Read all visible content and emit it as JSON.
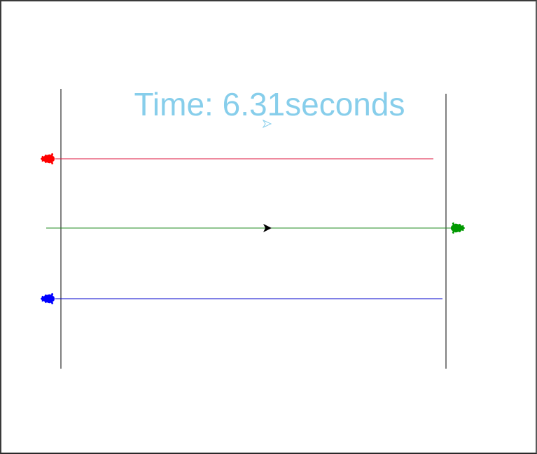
{
  "window": {
    "background": "#ffffff"
  },
  "timer": {
    "text": "Time: 6.31seconds",
    "color": "#87ceeb"
  },
  "lines": {
    "start_color": "#000000",
    "finish_color": "#000000"
  },
  "turtles": [
    {
      "name": "red",
      "color": "#ff0000",
      "trail_color": "#dc143c",
      "icon": "turtle-icon",
      "heading": "left"
    },
    {
      "name": "green",
      "color": "#009900",
      "trail_color": "#228b22",
      "icon": "turtle-icon",
      "heading": "right"
    },
    {
      "name": "blue",
      "color": "#0000ff",
      "trail_color": "#0000cd",
      "icon": "turtle-icon",
      "heading": "left"
    }
  ],
  "cursors": [
    {
      "name": "timer-writer-turtle",
      "color": "#87ceeb",
      "icon": "arrow-icon"
    },
    {
      "name": "pen-turtle",
      "color": "#000000",
      "icon": "arrow-icon"
    }
  ]
}
